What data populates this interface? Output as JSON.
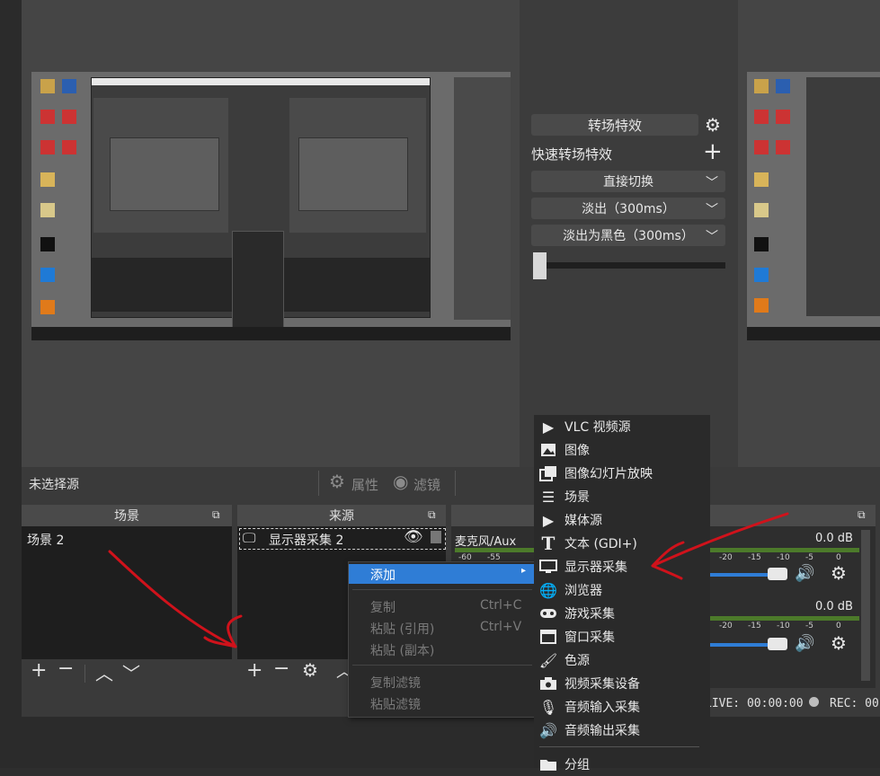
{
  "transitions": {
    "effect_label": "转场特效",
    "quick_label": "快速转场特效",
    "items": [
      "直接切换",
      "淡出（300ms）",
      "淡出为黑色（300ms）"
    ]
  },
  "status": {
    "no_source": "未选择源",
    "properties": "属性",
    "filters": "滤镜"
  },
  "scenes": {
    "title": "场景",
    "items": [
      "场景 2"
    ]
  },
  "sources": {
    "title": "来源",
    "items": [
      "显示器采集 2"
    ]
  },
  "mixer": {
    "track1_name": "麦克风/Aux",
    "track1_db": "0.0 dB",
    "track2_db": "0.0 dB",
    "scale": [
      "-60",
      "-55",
      "-20",
      "-15",
      "-10",
      "-5",
      "0"
    ]
  },
  "footer": {
    "live": "LIVE: 00:00:00",
    "rec": "REC: 00"
  },
  "context_menu": {
    "add": "添加",
    "copy": "复制",
    "copy_shortcut": "Ctrl+C",
    "paste_ref": "粘贴 (引用)",
    "paste_ref_shortcut": "Ctrl+V",
    "paste_dup": "粘贴 (副本)",
    "copy_filters": "复制滤镜",
    "paste_filters": "粘贴滤镜"
  },
  "add_menu": {
    "items": [
      {
        "label": "VLC 视频源",
        "icon": "play-icon"
      },
      {
        "label": "图像",
        "icon": "image-icon"
      },
      {
        "label": "图像幻灯片放映",
        "icon": "slideshow-icon"
      },
      {
        "label": "场景",
        "icon": "list-icon"
      },
      {
        "label": "媒体源",
        "icon": "play-icon"
      },
      {
        "label": "文本 (GDI+)",
        "icon": "text-icon"
      },
      {
        "label": "显示器采集",
        "icon": "monitor-icon"
      },
      {
        "label": "浏览器",
        "icon": "globe-icon"
      },
      {
        "label": "游戏采集",
        "icon": "gamepad-icon"
      },
      {
        "label": "窗口采集",
        "icon": "window-icon"
      },
      {
        "label": "色源",
        "icon": "brush-icon"
      },
      {
        "label": "视频采集设备",
        "icon": "camera-icon"
      },
      {
        "label": "音频输入采集",
        "icon": "microphone-icon"
      },
      {
        "label": "音频输出采集",
        "icon": "speaker-icon"
      },
      {
        "label": "分组",
        "icon": "folder-icon"
      }
    ]
  },
  "colors": {
    "highlight": "#2f7dd6",
    "annotation": "#d0121b",
    "volume_fill": "#2f7dd6"
  }
}
